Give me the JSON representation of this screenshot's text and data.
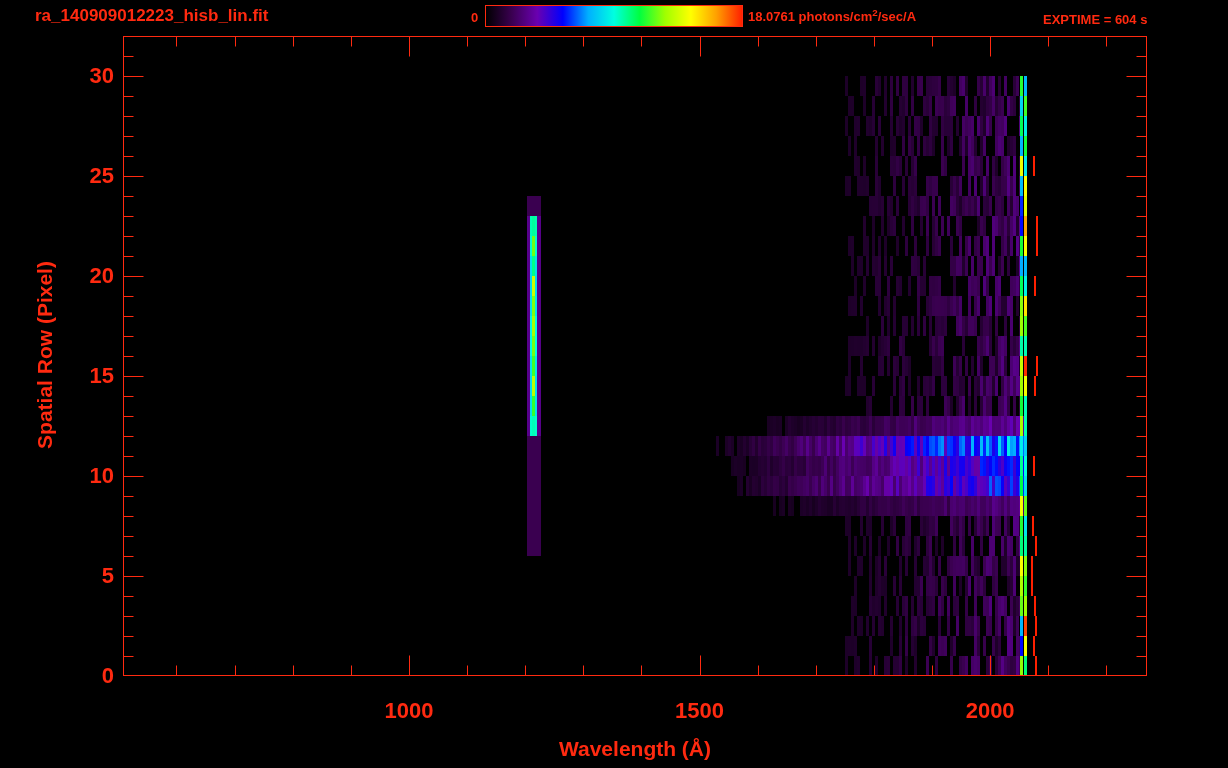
{
  "title": "ra_140909012223_hisb_lin.fit",
  "colorbar": {
    "min_label": "0",
    "max_label": "18.0761 photons/cm$^{2}$/sec/A"
  },
  "exposure": "EXPTIME = 604 s",
  "y_axis": {
    "label": "Spatial Row (Pixel)",
    "ticks": [
      "30",
      "25",
      "20",
      "15",
      "10",
      "5",
      "0"
    ]
  },
  "x_axis": {
    "label": "Wavelength (Å)",
    "ticks": [
      "1000",
      "1500",
      "2000"
    ]
  }
}
